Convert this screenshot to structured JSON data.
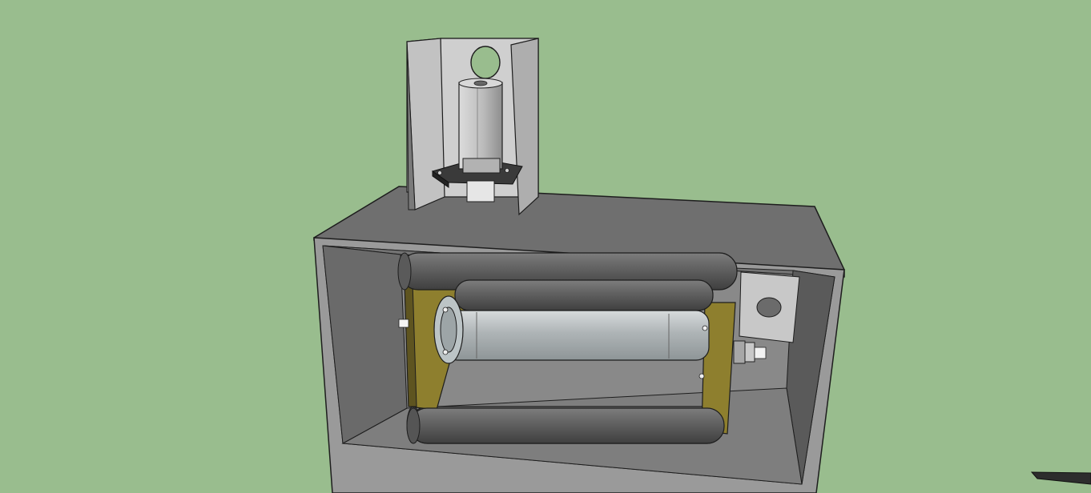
{
  "viewport": {
    "background_color": "#99bd8e"
  },
  "model": {
    "housing_color": "#707070",
    "housing_inner_color": "#8a8a8a",
    "bracket_color": "#c9c9c9",
    "roller_color": "#5f5f5f",
    "side_plate_color": "#8e7f2e",
    "drum_color": "#bfc3c4",
    "bearing_color": "#2f2f2f"
  },
  "tools": {
    "partial_tool_icon": "pencil-icon"
  }
}
